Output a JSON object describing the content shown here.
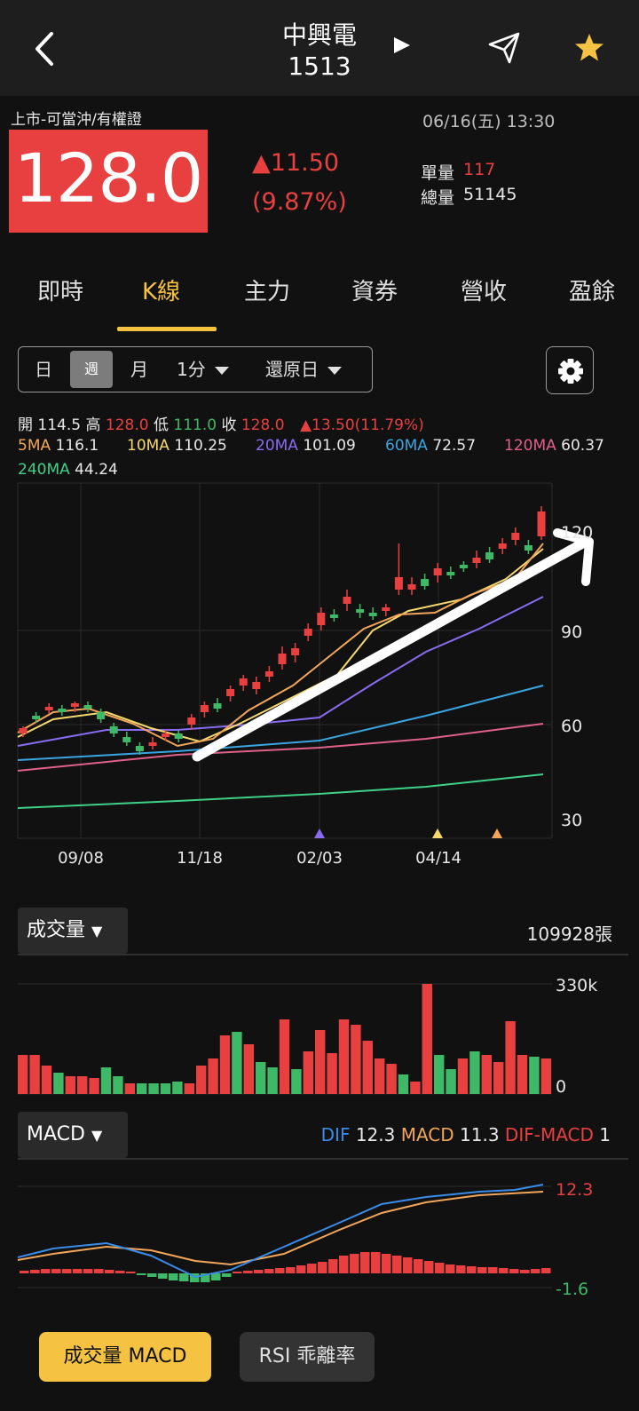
{
  "header": {
    "name": "中興電",
    "code": "1513"
  },
  "quote": {
    "market": "上市-可當沖/有權證",
    "time": "06/16(五) 13:30",
    "price": "128.0",
    "change": "▲11.50",
    "change_pct": "(9.87%)",
    "unit_vol_label": "單量",
    "unit_vol": "117",
    "total_vol_label": "總量",
    "total_vol": "51145"
  },
  "tabs": [
    "即時",
    "K線",
    "主力",
    "資券",
    "營收",
    "盈餘"
  ],
  "period": {
    "day": "日",
    "week": "週",
    "month": "月",
    "minute": "1分",
    "adjust": "還原日"
  },
  "ohlc": {
    "open_label": "開",
    "open": "114.5",
    "high_label": "高",
    "high": "128.0",
    "low_label": "低",
    "low": "111.0",
    "close_label": "收",
    "close": "128.0",
    "change": "▲13.50(11.79%)"
  },
  "ma": [
    {
      "label": "5MA",
      "value": "116.1",
      "color": "#f2a65a"
    },
    {
      "label": "10MA",
      "value": "110.25",
      "color": "#f5d86e"
    },
    {
      "label": "20MA",
      "value": "101.09",
      "color": "#8a6cf2"
    },
    {
      "label": "60MA",
      "value": "72.57",
      "color": "#3aa5e0"
    },
    {
      "label": "120MA",
      "value": "60.37",
      "color": "#e0608a"
    },
    {
      "label": "240MA",
      "value": "44.24",
      "color": "#3fd08a"
    }
  ],
  "kchart": {
    "y_ticks": [
      "120",
      "90",
      "60",
      "30"
    ],
    "x_ticks": [
      "09/08",
      "11/18",
      "02/03",
      "04/14"
    ]
  },
  "volume": {
    "selector": "成交量",
    "total": "109928張",
    "max_tick": "330k",
    "min_tick": "0"
  },
  "macd": {
    "selector": "MACD",
    "dif_label": "DIF",
    "dif": "12.3",
    "macd_label": "MACD",
    "macd": "11.3",
    "osc_label": "DIF-MACD",
    "osc": "1",
    "top_tick": "12.3",
    "bottom_tick": "-1.6"
  },
  "bottom": {
    "btn1": "成交量 MACD",
    "btn2": "RSI 乖離率"
  },
  "colors": {
    "up": "#e84040",
    "down": "#3fb868",
    "accent": "#f5c242"
  }
}
